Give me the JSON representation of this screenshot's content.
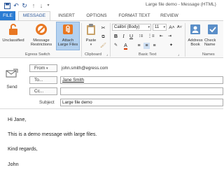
{
  "window": {
    "title": "Large file demo - Message (HTML)"
  },
  "quick_access": {
    "icons": [
      "save-icon",
      "undo-icon",
      "redo-icon",
      "up-arrow-icon",
      "down-arrow-icon",
      "customize-icon"
    ]
  },
  "ribbon_tabs": [
    "FILE",
    "MESSAGE",
    "INSERT",
    "OPTIONS",
    "FORMAT TEXT",
    "REVIEW"
  ],
  "active_tab": "MESSAGE",
  "ribbon": {
    "egress_switch": {
      "unclassified_label": "Unclassified",
      "message_restrictions_label1": "Message",
      "message_restrictions_label2": "Restrictions",
      "attach_large_files_label1": "Attach",
      "attach_large_files_label2": "Large Files",
      "group_label": "Egress Switch"
    },
    "clipboard": {
      "paste_label": "Paste",
      "group_label": "Clipboard"
    },
    "basic_text": {
      "font_name": "Calibri (Body)",
      "font_size": "11",
      "grow_label": "A˄",
      "shrink_label": "A˅",
      "bold_label": "B",
      "italic_label": "I",
      "underline_label": "U",
      "group_label": "Basic Text"
    },
    "names": {
      "address_book_label1": "Address",
      "address_book_label2": "Book",
      "check_names_label1": "Check",
      "check_names_label2": "Name",
      "group_label": "Names"
    }
  },
  "compose": {
    "send_label": "Send",
    "from_label": "From",
    "from_value": "john.smith@egress.com",
    "to_label": "To...",
    "to_value": "Jane Smith",
    "cc_label": "Cc...",
    "cc_value": "",
    "subject_label": "Subject",
    "subject_value": "Large file demo"
  },
  "message_body": [
    "Hi Jane,",
    "This is a demo message with large files.",
    "Kind regards,",
    "John"
  ],
  "colors": {
    "file_tab": "#2b7cd3",
    "accent_text": "#2b579a",
    "highlight": "#b3d1f0"
  }
}
